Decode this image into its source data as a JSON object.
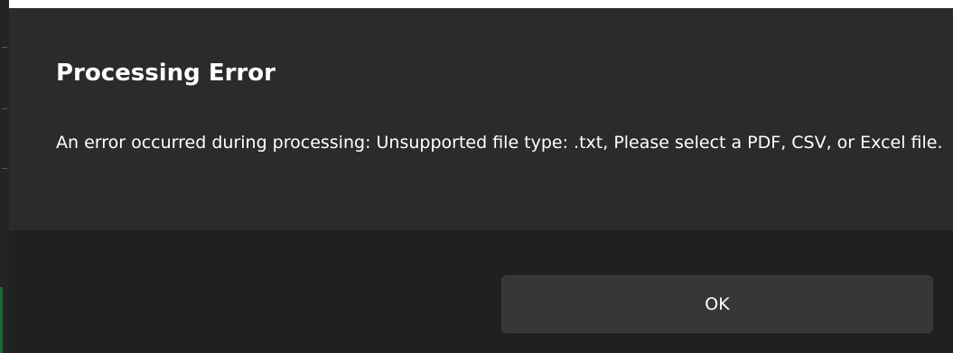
{
  "dialog": {
    "title": "Processing Error",
    "message": "An error occurred during processing: Unsupported file type: .txt, Please select a PDF, CSV, or Excel file.",
    "ok_label": "OK"
  },
  "colors": {
    "dialog_background": "#2b2b2b",
    "footer_background": "#202020",
    "button_background": "#373737",
    "text": "#ffffff"
  }
}
